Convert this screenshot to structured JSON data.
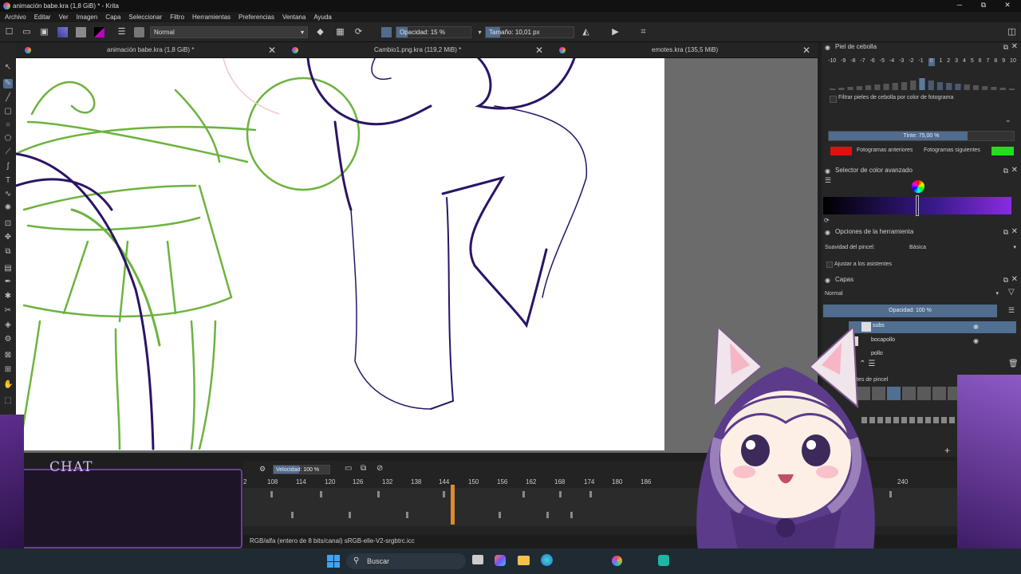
{
  "window": {
    "title": "animación babe.kra (1,8 GiB) * - Krita",
    "minimize": "─",
    "maximize": "⧉",
    "close": "✕"
  },
  "menu": [
    "Archivo",
    "Editar",
    "Ver",
    "Imagen",
    "Capa",
    "Seleccionar",
    "Filtro",
    "Herramientas",
    "Preferencias",
    "Ventana",
    "Ayuda"
  ],
  "toolbar": {
    "blend_mode": "Normal",
    "opacity_label": "Opacidad: 15 %",
    "opacity_value": 0.15,
    "size_label": "Tamaño: 10,01 px"
  },
  "tabs": [
    {
      "label": "animación babe.kra (1,8 GiB) *",
      "close": "✕"
    },
    {
      "label": "Cambio1.png.kra (119,2 MiB) *",
      "close": "✕"
    },
    {
      "label": "emotes.kra (135,5 MiB)",
      "close": "✕"
    }
  ],
  "onion_skin": {
    "title": "Piel de cebolla",
    "numbers": [
      "-10",
      "-9",
      "-8",
      "-7",
      "-6",
      "-5",
      "-4",
      "-3",
      "-2",
      "-1",
      "0",
      "1",
      "2",
      "3",
      "4",
      "5",
      "6",
      "7",
      "8",
      "9",
      "10"
    ],
    "filter_label": "Filtrar pieles de cebolla por color de fotograma",
    "tint_label": "Tinte: 75,00 %",
    "tint_value": 0.75,
    "previous_label": "Fotogramas anteriores",
    "next_label": "Fotogramas siguientes",
    "previous_color": "#e01010",
    "next_color": "#22dd22"
  },
  "color_selector": {
    "title": "Selector de color avanzado"
  },
  "tool_options": {
    "title": "Opciones de la herramienta",
    "smoothing_label": "Suavidad del pincel:",
    "smoothing_value": "Básica",
    "snap_label": "Ajustar a los asistentes"
  },
  "layers": {
    "title": "Capas",
    "blend_mode": "Normal",
    "opacity_label": "Opacidad: 100 %",
    "items": [
      {
        "name": "subs",
        "selected": true
      },
      {
        "name": "bocapollo",
        "selected": false
      },
      {
        "name": "pollo",
        "selected": false
      }
    ]
  },
  "brush_presets": {
    "title": "tes de pincel"
  },
  "timeline": {
    "speed_label": "Velocidad: 100 %",
    "frames": [
      "2",
      "108",
      "114",
      "120",
      "126",
      "132",
      "138",
      "144",
      "150",
      "156",
      "162",
      "168",
      "174",
      "180",
      "186",
      "240"
    ]
  },
  "status": {
    "text": "RGB/alfa (entero de 8 bits/canal)  sRGB-elle-V2-srgbtrc.icc"
  },
  "taskbar": {
    "search_label": "Buscar"
  },
  "overlay": {
    "chat_label": "CHAT"
  },
  "colors": {
    "accent": "#506c8e",
    "layer_selected": "#4f6f93",
    "sketch_green": "#6db33f",
    "line_purple": "#2a1466"
  }
}
